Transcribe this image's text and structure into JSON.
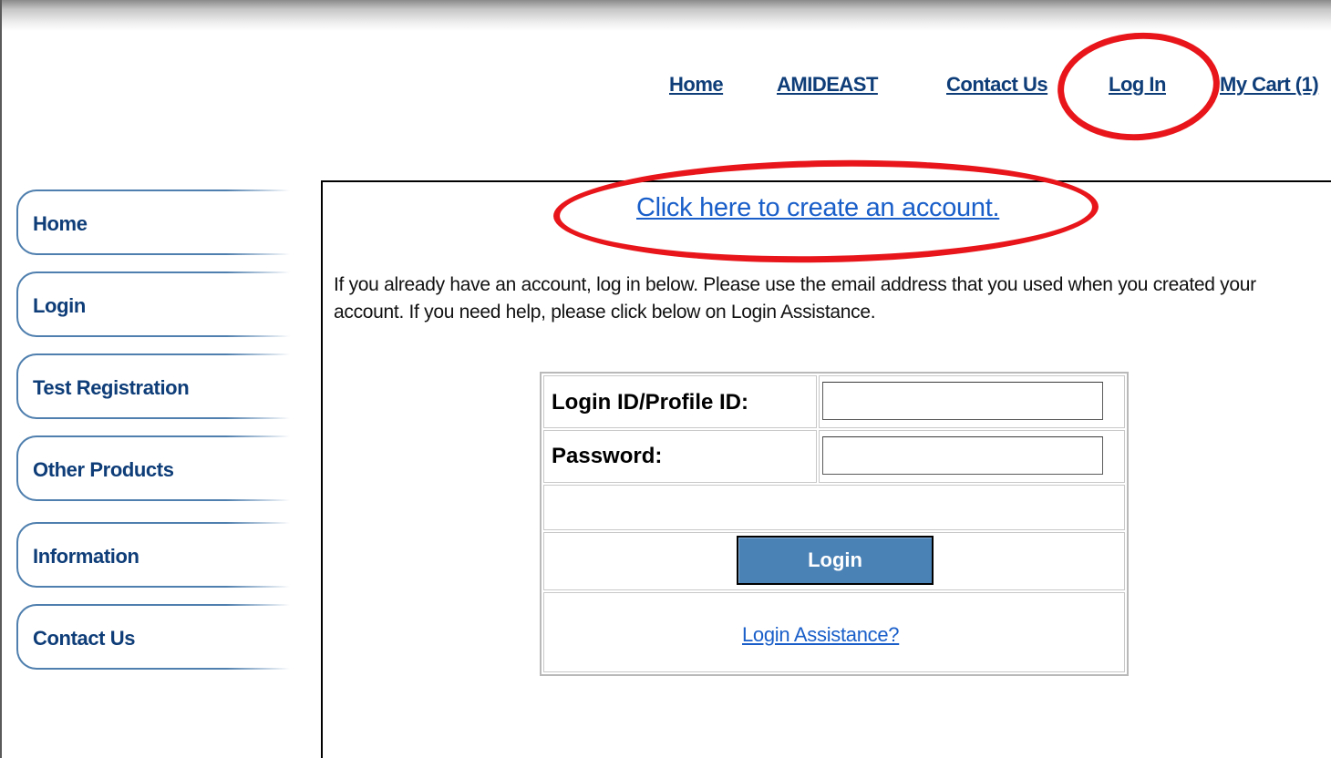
{
  "top_nav": {
    "home": "Home",
    "amideast": "AMIDEAST",
    "contact_us": "Contact Us",
    "log_in": "Log In",
    "my_cart": "My Cart (1)"
  },
  "sidebar": {
    "items": [
      {
        "label": "Home"
      },
      {
        "label": "Login"
      },
      {
        "label": "Test Registration"
      },
      {
        "label": "Other Products"
      },
      {
        "label": "Information"
      },
      {
        "label": "Contact Us"
      }
    ]
  },
  "main": {
    "create_account_link": "Click here to create an account.",
    "intro_text": "If you already have an account, log in below. Please use the email address that you used when you created your account. If you need help, please click below on Login Assistance."
  },
  "login_form": {
    "login_id_label": "Login ID/Profile ID:",
    "login_id_value": "",
    "password_label": "Password:",
    "password_value": "",
    "login_button": "Login",
    "assistance_link": "Login Assistance?"
  },
  "colors": {
    "nav_link": "#0e3d78",
    "link_blue": "#1a5fc9",
    "button_blue": "#4b82b6",
    "annotation_red": "#e8161a",
    "sidebar_border": "#4f7fae"
  }
}
